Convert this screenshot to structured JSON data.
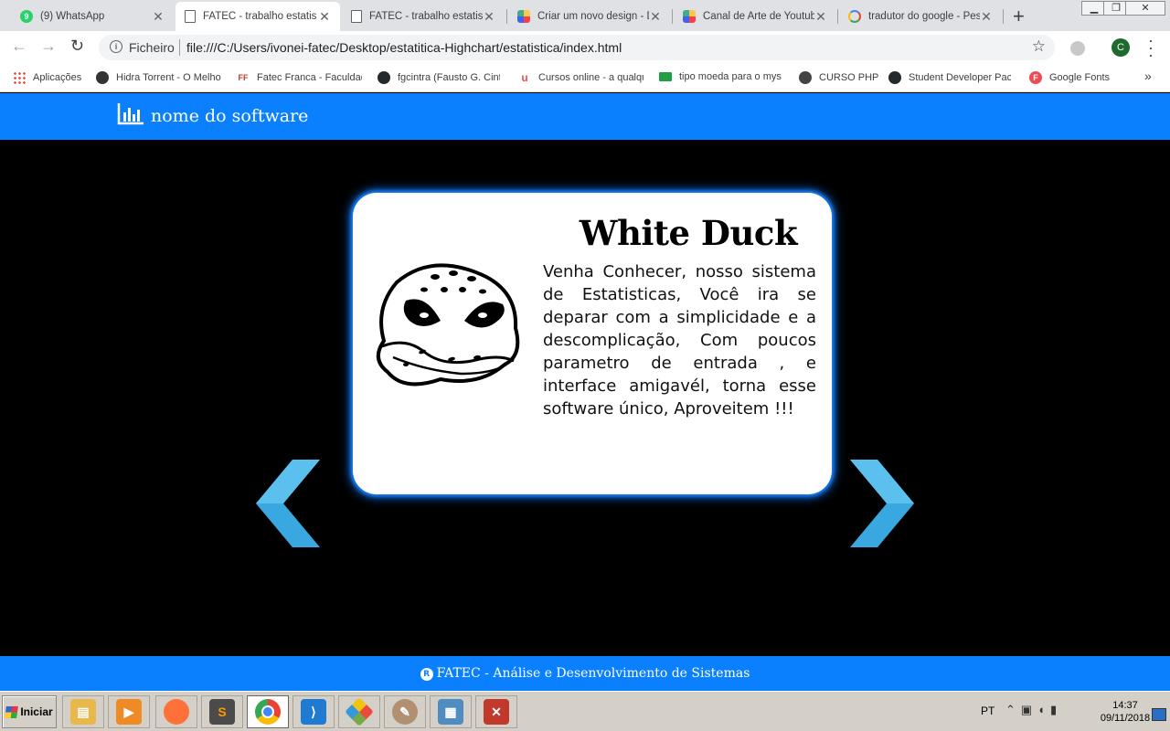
{
  "browser": {
    "tabs": [
      {
        "title": "(9) WhatsApp",
        "icon": "whatsapp-icon",
        "badge": "9",
        "active": false
      },
      {
        "title": "FATEC - trabalho estatis",
        "icon": "document-icon",
        "active": true
      },
      {
        "title": "FATEC - trabalho estatis",
        "icon": "document-icon",
        "active": false
      },
      {
        "title": "Criar um novo design - D",
        "icon": "canva-icon",
        "active": false
      },
      {
        "title": "Canal de Arte de Youtub",
        "icon": "canva-icon",
        "active": false
      },
      {
        "title": "tradutor do google - Pes",
        "icon": "google-icon",
        "active": false
      }
    ],
    "new_tab_label": "+",
    "address_bar": {
      "scheme_label": "Ficheiro",
      "url": "file:///C:/Users/ivonei-fatec/Desktop/estatitica-Highchart/estatistica/index.html"
    },
    "profile_initial": "C",
    "bookmarks": [
      {
        "label": "Aplicações",
        "icon": "apps-grid-icon"
      },
      {
        "label": "Hidra Torrent - O Melho",
        "icon": "hydra-icon"
      },
      {
        "label": "Fatec Franca - Faculdac",
        "icon": "fatec-icon",
        "badge": "FF"
      },
      {
        "label": "fgcintra (Fausto G. Cint",
        "icon": "github-icon"
      },
      {
        "label": "Cursos online - a qualqu",
        "icon": "udemy-icon",
        "badge": "u"
      },
      {
        "label": "tipo moeda para o mysq",
        "icon": "brazil-flag-icon"
      },
      {
        "label": "CURSO PHP",
        "icon": "php-icon"
      },
      {
        "label": "Student Developer Pacl",
        "icon": "github-icon"
      },
      {
        "label": "Google Fonts",
        "icon": "google-fonts-icon",
        "badge": "F"
      }
    ],
    "bookmarks_overflow": "»"
  },
  "page": {
    "header": {
      "logo_icon": "bar-chart-icon",
      "software_name": "nome do software"
    },
    "carousel": {
      "card": {
        "title": "White Duck",
        "image": "angry-duck-mask-logo",
        "text": "Venha Conhecer, nosso sistema de Estatisticas, Você ira se deparar com a simplicidade e a descomplicação, Com poucos parametro de entrada , e interface amigavél, torna esse software único, Aproveitem !!!"
      },
      "prev_icon": "chevron-left-icon",
      "next_icon": "chevron-right-icon",
      "arrow_color": "#3aa8e0"
    },
    "footer": {
      "registered_symbol": "R",
      "text": "FATEC - Análise e Desenvolvimento de Sistemas"
    },
    "colors": {
      "primary_blue": "#0a80ff",
      "background": "#000000",
      "card_glow": "#1e88ff"
    }
  },
  "taskbar": {
    "start_label": "Iniciar",
    "apps": [
      {
        "name": "file-explorer-icon",
        "color": "#e8b84a"
      },
      {
        "name": "media-player-icon",
        "color": "#f08a24"
      },
      {
        "name": "firefox-icon",
        "color": "#ff7139"
      },
      {
        "name": "sublime-text-icon",
        "color": "#4b4b4b"
      },
      {
        "name": "chrome-icon",
        "color": "#4285f4"
      },
      {
        "name": "vscode-icon",
        "color": "#1f7ad1"
      },
      {
        "name": "tiles-app-icon",
        "color": "#78a848"
      },
      {
        "name": "paint-icon",
        "color": "#b09070"
      },
      {
        "name": "image-viewer-icon",
        "color": "#4e8cc2"
      },
      {
        "name": "access-db-icon",
        "color": "#c0392b"
      }
    ],
    "language": "PT",
    "time": "14:37",
    "date": "09/11/2018"
  }
}
